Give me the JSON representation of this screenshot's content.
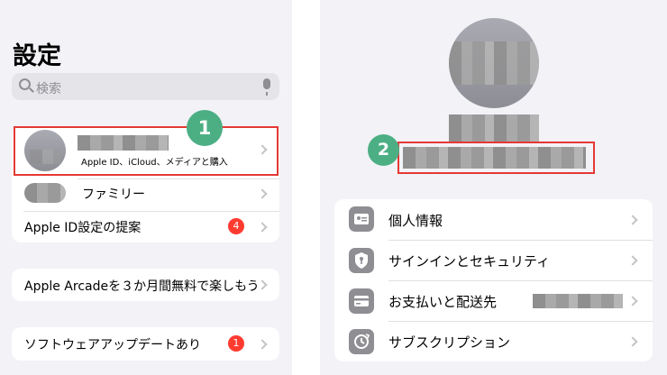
{
  "left": {
    "title": "設定",
    "search_placeholder": "検索",
    "account": {
      "subtitle": "Apple ID、iCloud、メディアと購入"
    },
    "family_label": "ファミリー",
    "suggest_label": "Apple ID設定の提案",
    "suggest_badge": "4",
    "arcade_label": "Apple Arcadeを３か月間無料で楽しもう",
    "update_label": "ソフトウェアアップデートあり",
    "update_badge": "1"
  },
  "markers": {
    "one": "1",
    "two": "2"
  },
  "right": {
    "menu": [
      {
        "label": "個人情報"
      },
      {
        "label": "サインインとセキュリティ"
      },
      {
        "label": "お支払いと配送先"
      },
      {
        "label": "サブスクリプション"
      }
    ]
  },
  "colors": {
    "highlight_border": "#e53935",
    "marker_green": "#4caf84",
    "badge_red": "#ff3b30",
    "background": "#f2f2f7"
  }
}
